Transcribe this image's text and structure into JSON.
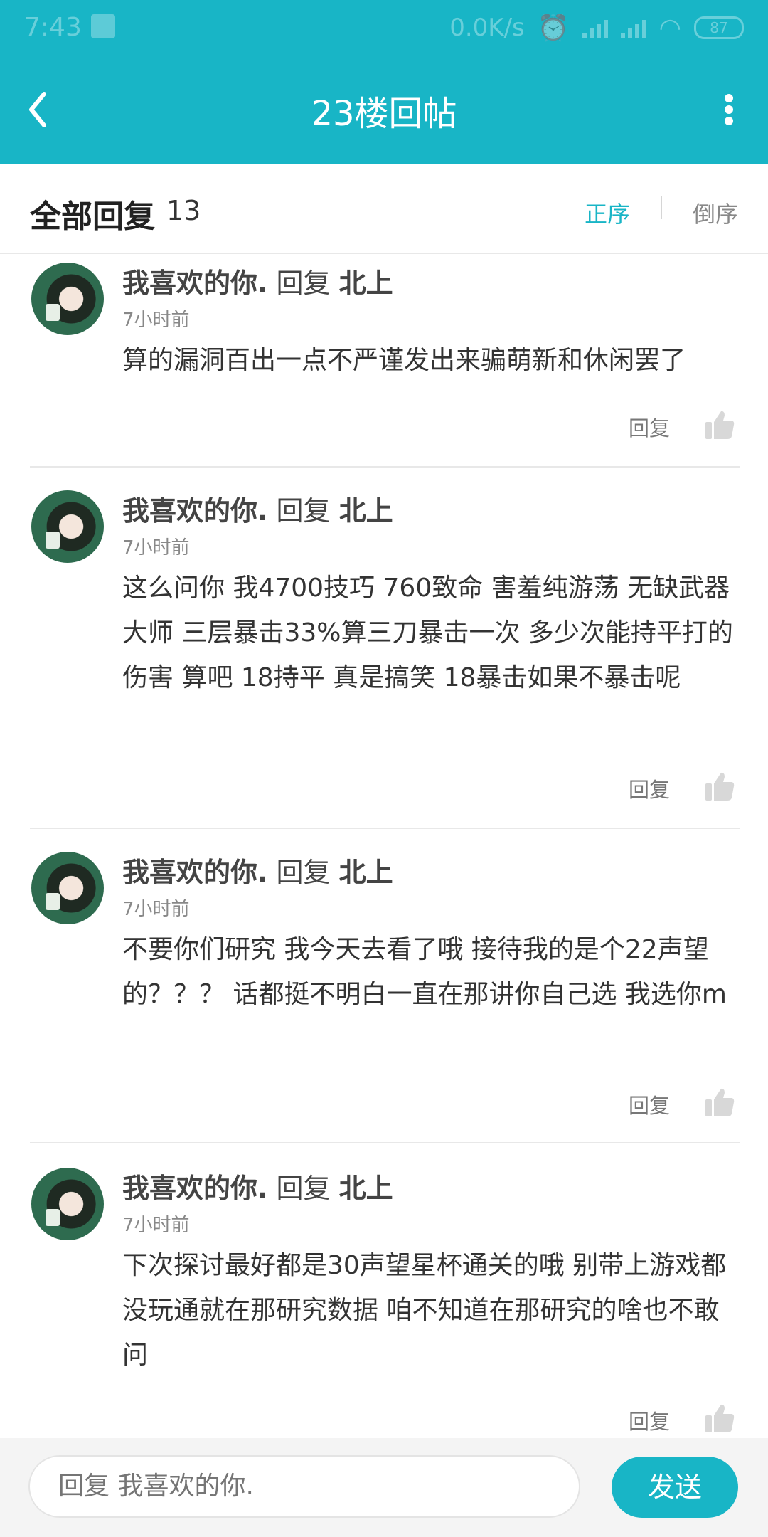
{
  "status_bar": {
    "time": "7:43",
    "net_speed": "0.0K/s",
    "battery": "87"
  },
  "header": {
    "title": "23楼回帖",
    "back_icon": "chevron-left-icon",
    "more_icon": "more-vertical-icon"
  },
  "replies_header": {
    "title": "全部回复",
    "count": "13",
    "sort_asc": "正序",
    "sort_desc": "倒序"
  },
  "replies": [
    {
      "author": "我喜欢的你.",
      "reply_word": "回复",
      "target": "北上",
      "time": "7小时前",
      "content": "算的漏洞百出一点不严谨发出来骗萌新和休闲罢了",
      "reply_label": "回复"
    },
    {
      "author": "我喜欢的你.",
      "reply_word": "回复",
      "target": "北上",
      "time": "7小时前",
      "content": "这么问你 我4700技巧 760致命 害羞纯游荡 无缺武器大师 三层暴击33%算三刀暴击一次 多少次能持平打的伤害 算吧 18持平 真是搞笑  18暴击如果不暴击呢",
      "reply_label": "回复"
    },
    {
      "author": "我喜欢的你.",
      "reply_word": "回复",
      "target": "北上",
      "time": "7小时前",
      "content": "不要你们研究 我今天去看了哦 接待我的是个22声望的？？？ 话都挺不明白一直在那讲你自己选 我选你m",
      "reply_label": "回复"
    },
    {
      "author": "我喜欢的你.",
      "reply_word": "回复",
      "target": "北上",
      "time": "7小时前",
      "content": "下次探讨最好都是30声望星杯通关的哦 别带上游戏都没玩通就在那研究数据 咱不知道在那研究的啥也不敢问",
      "reply_label": "回复"
    }
  ],
  "footer": {
    "input_placeholder": "回复 我喜欢的你.",
    "send_label": "发送"
  },
  "colors": {
    "accent": "#18b5c6",
    "text": "#333333",
    "muted": "#888888"
  }
}
